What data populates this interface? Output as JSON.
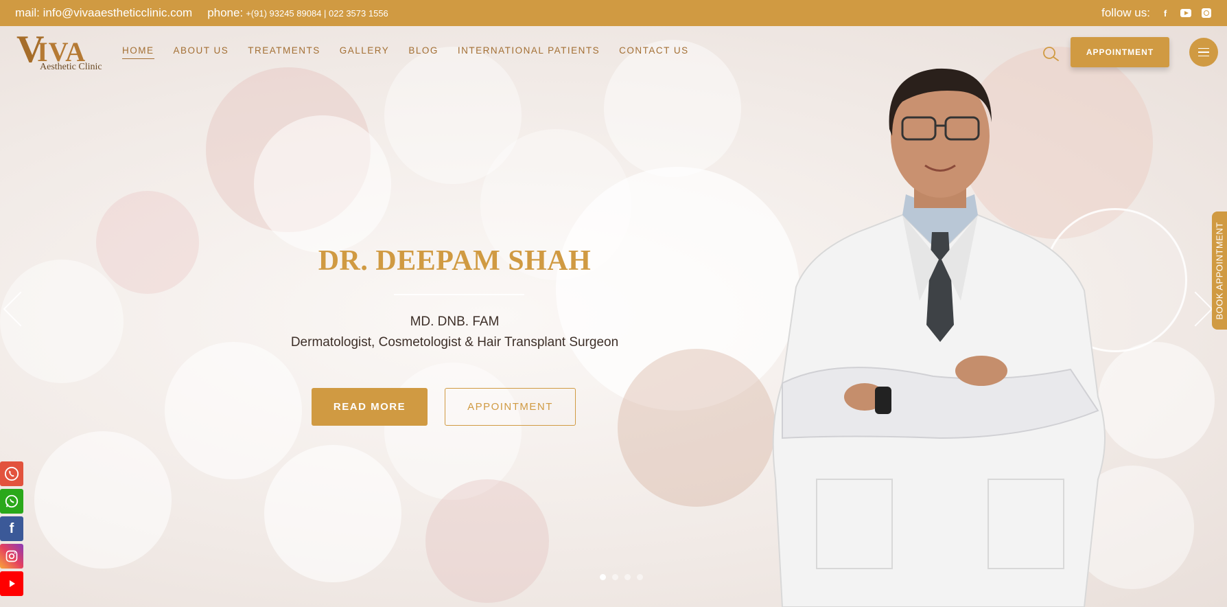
{
  "topbar": {
    "mail": "mail: info@vivaaestheticclinic.com",
    "phone_label": "phone:",
    "phone_numbers": "+(91) 93245 89084 | 022 3573 1556",
    "follow": "follow us:",
    "social_icons": [
      "facebook-icon",
      "youtube-icon",
      "instagram-icon"
    ]
  },
  "logo": {
    "mark": "V",
    "name": "IVA",
    "subtitle": "Aesthetic Clinic"
  },
  "nav": {
    "items": [
      "HOME",
      "ABOUT US",
      "TREATMENTS",
      "GALLERY",
      "BLOG",
      "INTERNATIONAL PATIENTS",
      "CONTACT US"
    ],
    "active": "HOME"
  },
  "header": {
    "appointment_label": "APPOINTMENT"
  },
  "hero": {
    "title": "DR. DEEPAM SHAH",
    "qualifications": "MD. DNB. FAM",
    "specialty": "Dermatologist, Cosmetologist & Hair Transplant Surgeon",
    "read_more": "READ MORE",
    "appointment": "APPOINTMENT",
    "slides": 4,
    "active_slide": 1
  },
  "side_tab": {
    "label": "BOOK APPOINTMENT"
  },
  "floating_icons": [
    "phone-icon",
    "whatsapp-icon",
    "facebook-icon",
    "instagram-icon",
    "youtube-icon"
  ],
  "colors": {
    "accent": "#d09a42",
    "nav_text": "#a36f33",
    "body_text": "#3d2f28"
  }
}
